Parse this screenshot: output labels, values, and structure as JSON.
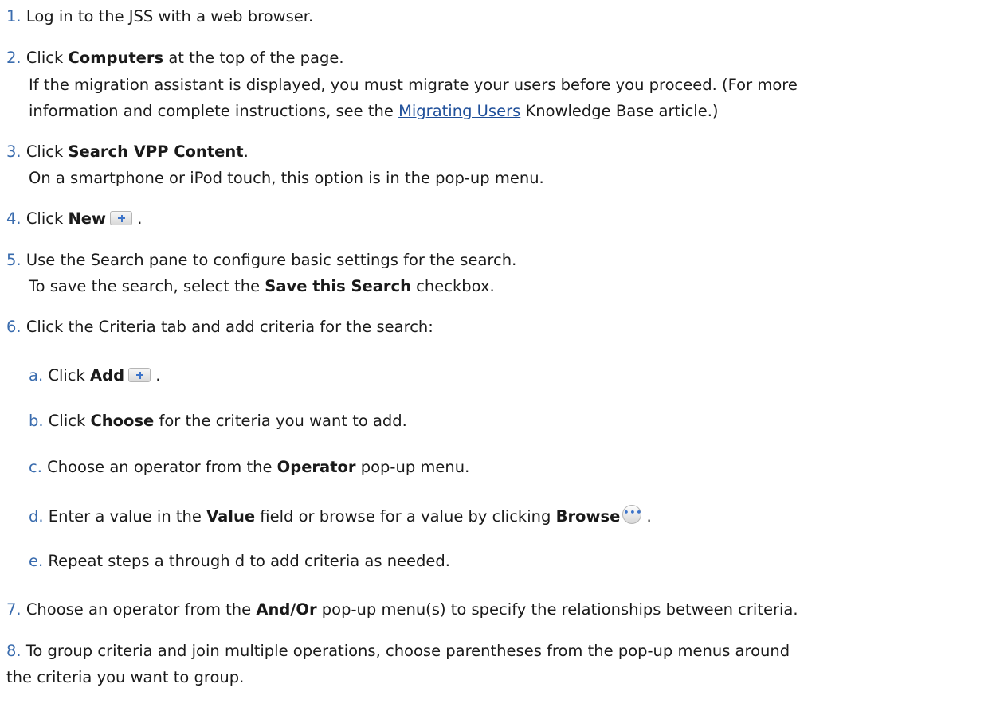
{
  "steps": [
    {
      "num": "1.",
      "text": "Log in to the JSS with a web browser."
    },
    {
      "num": "2.",
      "pre": "Click ",
      "bold": "Computers",
      "post": " at the top of the page.",
      "note1_pre": "If the migration assistant is displayed, you must migrate your users before you proceed. (For more",
      "note2_pre": "information and complete instructions, see the ",
      "note2_link": "Migrating Users",
      "note2_post": " Knowledge Base article.)"
    },
    {
      "num": "3.",
      "pre": "Click ",
      "bold": "Search VPP Content",
      "post": ".",
      "note": "On a smartphone or iPod touch, this option is in the pop-up menu."
    },
    {
      "num": "4.",
      "pre": "Click ",
      "bold": "New",
      "post": " ."
    },
    {
      "num": "5.",
      "text": "Use the Search pane to configure basic settings for the search.",
      "note_pre": "To save the search, select the ",
      "note_bold": "Save this Search",
      "note_post": " checkbox."
    },
    {
      "num": "6.",
      "text": "Click the Criteria tab and add criteria for the search:"
    },
    {
      "num": "7.",
      "pre": "Choose an operator from the ",
      "bold": "And/Or",
      "post": " pop-up menu(s) to specify the relationships between criteria."
    },
    {
      "num": "8.",
      "line1": "To group criteria and join multiple operations, choose parentheses from the pop-up menus around",
      "line2": "the criteria you want to group."
    }
  ],
  "substeps": [
    {
      "num": "a.",
      "pre": "Click ",
      "bold": "Add",
      "post": " ."
    },
    {
      "num": "b.",
      "pre": "Click ",
      "bold": "Choose",
      "post": " for the criteria you want to add."
    },
    {
      "num": "c.",
      "pre": "Choose an operator from the ",
      "bold": "Operator",
      "post": " pop-up menu."
    },
    {
      "num": "d.",
      "pre": "Enter a value in the ",
      "bold": "Value",
      "mid": " field or browse for a value by clicking ",
      "bold2": "Browse",
      "post": " ."
    },
    {
      "num": "e.",
      "text": "Repeat steps a through d to add criteria as needed."
    }
  ],
  "icons": {
    "plus": "plus-button-icon",
    "browse": "ellipsis-button-icon"
  },
  "colors": {
    "number": "#3a6cae",
    "link": "#1f4f9a"
  }
}
